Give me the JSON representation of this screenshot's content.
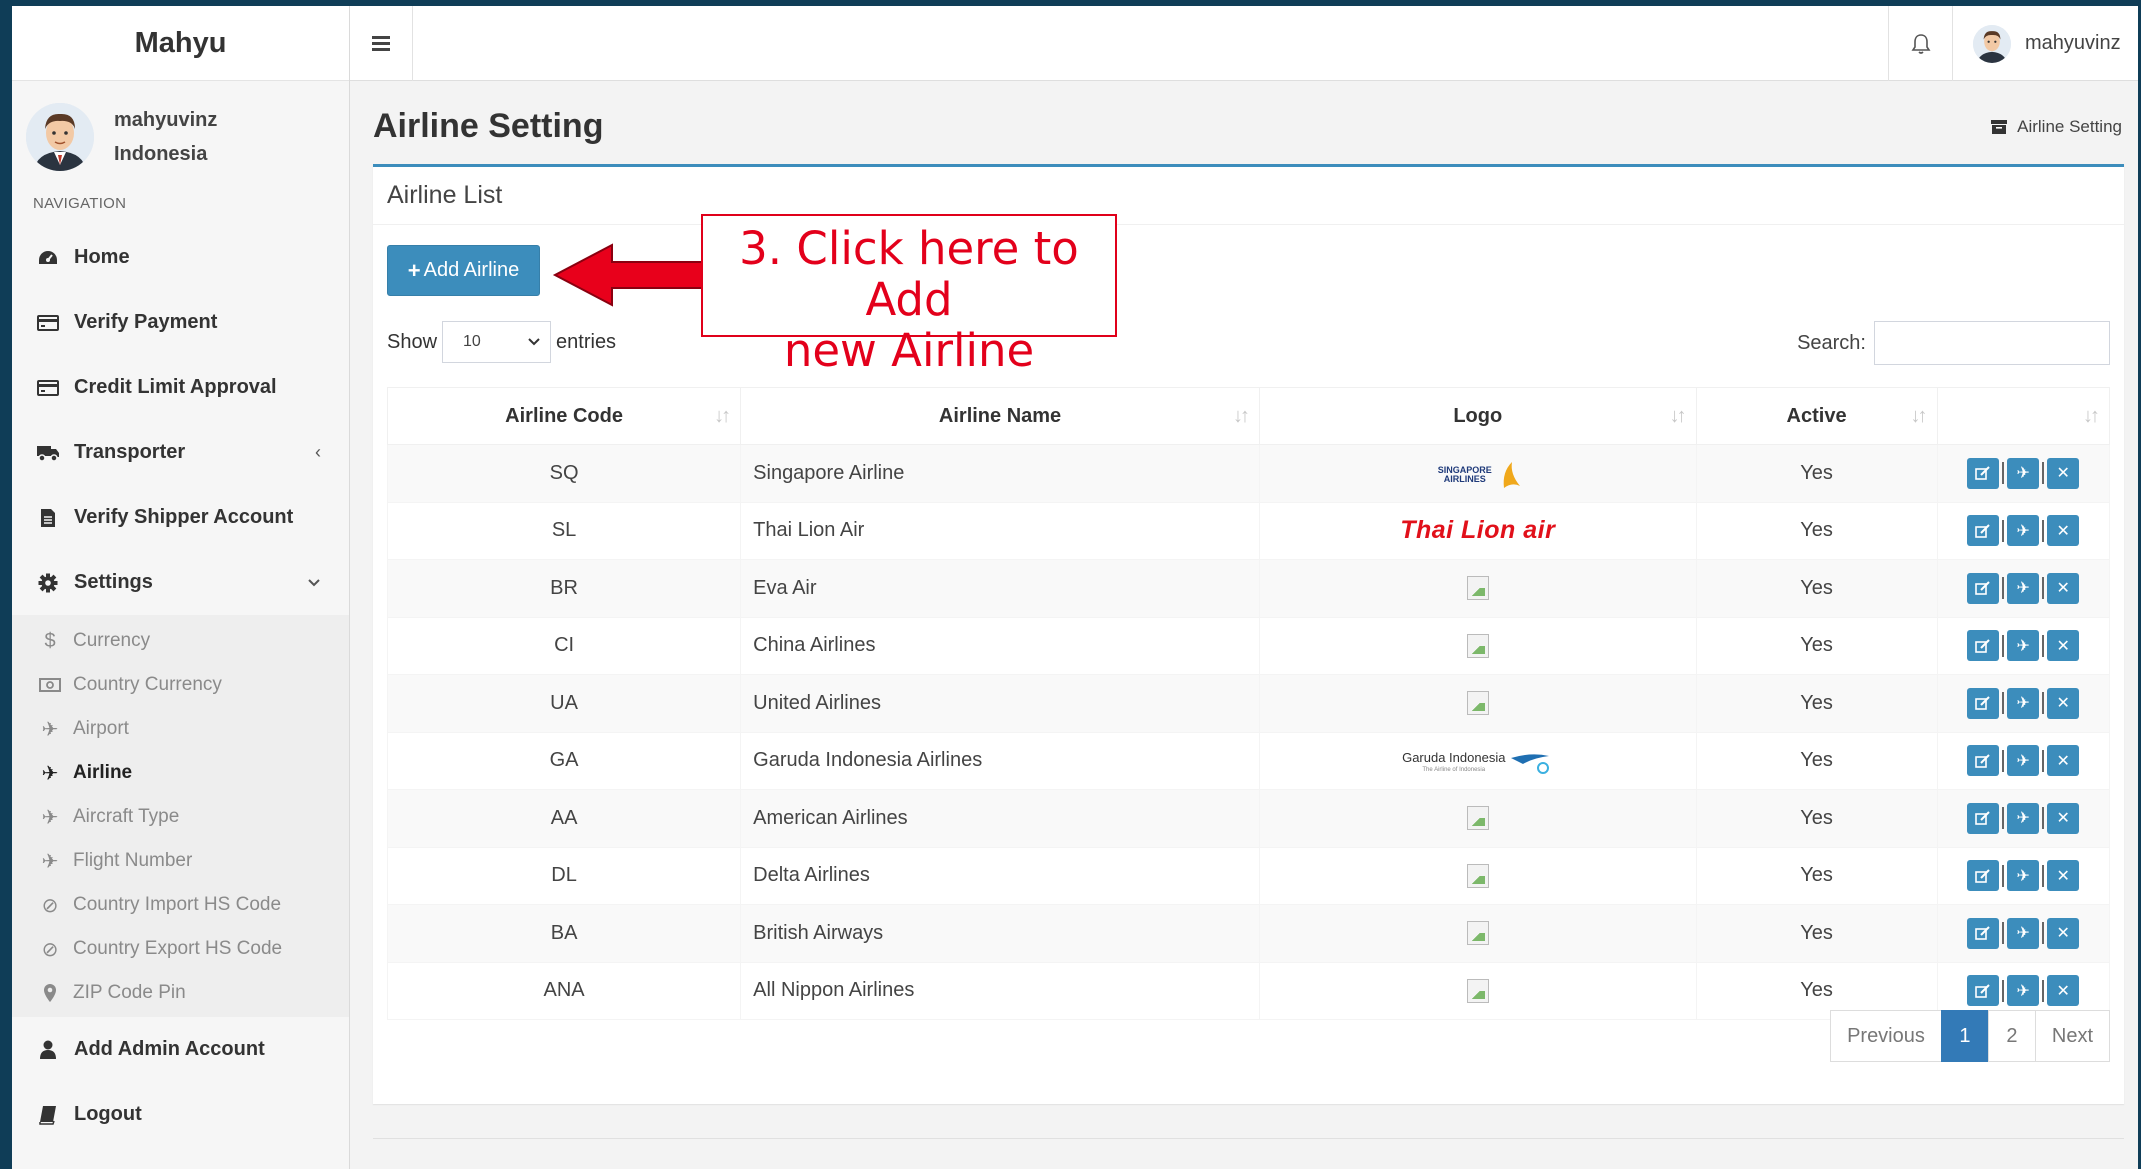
{
  "app": {
    "brand": "Mahyu",
    "user": {
      "name": "mahyuvinz",
      "country": "Indonesia"
    }
  },
  "sidebar": {
    "nav_header": "NAVIGATION",
    "items": [
      {
        "label": "Home",
        "icon": "dashboard-icon"
      },
      {
        "label": "Verify Payment",
        "icon": "credit-card-icon"
      },
      {
        "label": "Credit Limit Approval",
        "icon": "credit-card-icon"
      },
      {
        "label": "Transporter",
        "icon": "truck-icon",
        "caret": "‹"
      },
      {
        "label": "Verify Shipper Account",
        "icon": "file-icon"
      },
      {
        "label": "Settings",
        "icon": "gear-icon",
        "caret": "⌄"
      }
    ],
    "submenu": [
      {
        "label": "Currency",
        "icon": "dollar-icon"
      },
      {
        "label": "Country Currency",
        "icon": "money-icon"
      },
      {
        "label": "Airport",
        "icon": "plane-icon"
      },
      {
        "label": "Airline",
        "icon": "plane-icon",
        "active": true
      },
      {
        "label": "Aircraft Type",
        "icon": "plane-icon"
      },
      {
        "label": "Flight Number",
        "icon": "plane-icon"
      },
      {
        "label": "Country Import HS Code",
        "icon": "ban-icon"
      },
      {
        "label": "Country Export HS Code",
        "icon": "ban-icon"
      },
      {
        "label": "ZIP Code Pin",
        "icon": "map-marker-icon"
      }
    ],
    "bottom_items": [
      {
        "label": "Add Admin Account",
        "icon": "user-icon"
      },
      {
        "label": "Logout",
        "icon": "book-icon"
      }
    ]
  },
  "topbar": {
    "menu_icon": "hamburger-icon",
    "notification_icon": "bell-icon",
    "user_name": "mahyuvinz"
  },
  "page": {
    "title": "Airline Setting",
    "breadcrumb": "Airline Setting",
    "box_title": "Airline List",
    "add_button": "Add Airline",
    "show_label": "Show",
    "entries_value": "10",
    "entries_label": "entries",
    "search_label": "Search:",
    "search_value": ""
  },
  "table": {
    "columns": [
      "Airline Code",
      "Airline Name",
      "Logo",
      "Active",
      ""
    ],
    "rows": [
      {
        "code": "SQ",
        "name": "Singapore Airline",
        "logo": "singapore",
        "active": "Yes"
      },
      {
        "code": "SL",
        "name": "Thai Lion Air",
        "logo": "thailion",
        "active": "Yes"
      },
      {
        "code": "BR",
        "name": "Eva Air",
        "logo": "broken",
        "active": "Yes"
      },
      {
        "code": "CI",
        "name": "China Airlines",
        "logo": "broken",
        "active": "Yes"
      },
      {
        "code": "UA",
        "name": "United Airlines",
        "logo": "broken",
        "active": "Yes"
      },
      {
        "code": "GA",
        "name": "Garuda Indonesia Airlines",
        "logo": "garuda",
        "active": "Yes"
      },
      {
        "code": "AA",
        "name": "American Airlines",
        "logo": "broken",
        "active": "Yes"
      },
      {
        "code": "DL",
        "name": "Delta Airlines",
        "logo": "broken",
        "active": "Yes"
      },
      {
        "code": "BA",
        "name": "British Airways",
        "logo": "broken",
        "active": "Yes"
      },
      {
        "code": "ANA",
        "name": "All Nippon Airlines",
        "logo": "broken",
        "active": "Yes"
      }
    ],
    "logo_text": {
      "singapore": "SINGAPORE AIRLINES",
      "thailion": "Thai Lion air",
      "garuda": "Garuda Indonesia",
      "garuda_tag": "The Airline of Indonesia"
    },
    "row_actions": [
      "edit-icon",
      "plane-icon",
      "delete-icon"
    ]
  },
  "pagination": {
    "previous": "Previous",
    "pages": [
      "1",
      "2"
    ],
    "current": "1",
    "next": "Next"
  },
  "annotation": {
    "text_line1": "3. Click here to Add",
    "text_line2": "new Airline"
  },
  "colors": {
    "primary": "#3c8dbc",
    "annotation": "#e3001b",
    "page_active": "#337ab7"
  }
}
